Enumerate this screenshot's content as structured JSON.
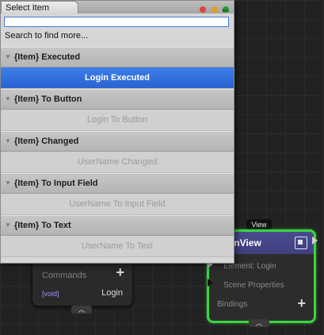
{
  "window": {
    "tab_title": "Select Item",
    "search_value": "",
    "search_hint": "Search to find more..."
  },
  "groups": [
    {
      "label": "{Item} Executed",
      "item": "Login Executed",
      "selected": true
    },
    {
      "label": "{Item} To Button",
      "item": "Login To Button",
      "selected": false
    },
    {
      "label": "{Item} Changed",
      "item": "UserName Changed",
      "selected": false
    },
    {
      "label": "{Item} To Input Field",
      "item": "UserName To Input Field",
      "selected": false
    },
    {
      "label": "{Item} To Text",
      "item": "UserName To Text",
      "selected": false
    }
  ],
  "left_node": {
    "commands_label": "Commands",
    "void_label": "[void]",
    "command_name": "Login"
  },
  "right_node": {
    "tag": "View",
    "title_partial": "inView",
    "element_row": "Element: Login",
    "scene_row": "Scene Properties",
    "bindings_row": "Bindings"
  },
  "colors": {
    "selection": "#2f6bdc",
    "node_border": "#38d640",
    "node_header": "#45468a"
  }
}
